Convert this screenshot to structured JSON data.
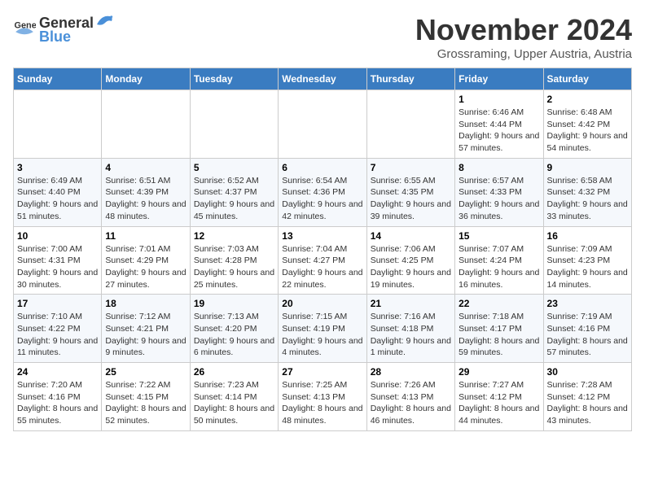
{
  "logo": {
    "text_general": "General",
    "text_blue": "Blue"
  },
  "header": {
    "month_year": "November 2024",
    "location": "Grossraming, Upper Austria, Austria"
  },
  "days_of_week": [
    "Sunday",
    "Monday",
    "Tuesday",
    "Wednesday",
    "Thursday",
    "Friday",
    "Saturday"
  ],
  "weeks": [
    [
      {
        "day": "",
        "detail": ""
      },
      {
        "day": "",
        "detail": ""
      },
      {
        "day": "",
        "detail": ""
      },
      {
        "day": "",
        "detail": ""
      },
      {
        "day": "",
        "detail": ""
      },
      {
        "day": "1",
        "detail": "Sunrise: 6:46 AM\nSunset: 4:44 PM\nDaylight: 9 hours and 57 minutes."
      },
      {
        "day": "2",
        "detail": "Sunrise: 6:48 AM\nSunset: 4:42 PM\nDaylight: 9 hours and 54 minutes."
      }
    ],
    [
      {
        "day": "3",
        "detail": "Sunrise: 6:49 AM\nSunset: 4:40 PM\nDaylight: 9 hours and 51 minutes."
      },
      {
        "day": "4",
        "detail": "Sunrise: 6:51 AM\nSunset: 4:39 PM\nDaylight: 9 hours and 48 minutes."
      },
      {
        "day": "5",
        "detail": "Sunrise: 6:52 AM\nSunset: 4:37 PM\nDaylight: 9 hours and 45 minutes."
      },
      {
        "day": "6",
        "detail": "Sunrise: 6:54 AM\nSunset: 4:36 PM\nDaylight: 9 hours and 42 minutes."
      },
      {
        "day": "7",
        "detail": "Sunrise: 6:55 AM\nSunset: 4:35 PM\nDaylight: 9 hours and 39 minutes."
      },
      {
        "day": "8",
        "detail": "Sunrise: 6:57 AM\nSunset: 4:33 PM\nDaylight: 9 hours and 36 minutes."
      },
      {
        "day": "9",
        "detail": "Sunrise: 6:58 AM\nSunset: 4:32 PM\nDaylight: 9 hours and 33 minutes."
      }
    ],
    [
      {
        "day": "10",
        "detail": "Sunrise: 7:00 AM\nSunset: 4:31 PM\nDaylight: 9 hours and 30 minutes."
      },
      {
        "day": "11",
        "detail": "Sunrise: 7:01 AM\nSunset: 4:29 PM\nDaylight: 9 hours and 27 minutes."
      },
      {
        "day": "12",
        "detail": "Sunrise: 7:03 AM\nSunset: 4:28 PM\nDaylight: 9 hours and 25 minutes."
      },
      {
        "day": "13",
        "detail": "Sunrise: 7:04 AM\nSunset: 4:27 PM\nDaylight: 9 hours and 22 minutes."
      },
      {
        "day": "14",
        "detail": "Sunrise: 7:06 AM\nSunset: 4:25 PM\nDaylight: 9 hours and 19 minutes."
      },
      {
        "day": "15",
        "detail": "Sunrise: 7:07 AM\nSunset: 4:24 PM\nDaylight: 9 hours and 16 minutes."
      },
      {
        "day": "16",
        "detail": "Sunrise: 7:09 AM\nSunset: 4:23 PM\nDaylight: 9 hours and 14 minutes."
      }
    ],
    [
      {
        "day": "17",
        "detail": "Sunrise: 7:10 AM\nSunset: 4:22 PM\nDaylight: 9 hours and 11 minutes."
      },
      {
        "day": "18",
        "detail": "Sunrise: 7:12 AM\nSunset: 4:21 PM\nDaylight: 9 hours and 9 minutes."
      },
      {
        "day": "19",
        "detail": "Sunrise: 7:13 AM\nSunset: 4:20 PM\nDaylight: 9 hours and 6 minutes."
      },
      {
        "day": "20",
        "detail": "Sunrise: 7:15 AM\nSunset: 4:19 PM\nDaylight: 9 hours and 4 minutes."
      },
      {
        "day": "21",
        "detail": "Sunrise: 7:16 AM\nSunset: 4:18 PM\nDaylight: 9 hours and 1 minute."
      },
      {
        "day": "22",
        "detail": "Sunrise: 7:18 AM\nSunset: 4:17 PM\nDaylight: 8 hours and 59 minutes."
      },
      {
        "day": "23",
        "detail": "Sunrise: 7:19 AM\nSunset: 4:16 PM\nDaylight: 8 hours and 57 minutes."
      }
    ],
    [
      {
        "day": "24",
        "detail": "Sunrise: 7:20 AM\nSunset: 4:16 PM\nDaylight: 8 hours and 55 minutes."
      },
      {
        "day": "25",
        "detail": "Sunrise: 7:22 AM\nSunset: 4:15 PM\nDaylight: 8 hours and 52 minutes."
      },
      {
        "day": "26",
        "detail": "Sunrise: 7:23 AM\nSunset: 4:14 PM\nDaylight: 8 hours and 50 minutes."
      },
      {
        "day": "27",
        "detail": "Sunrise: 7:25 AM\nSunset: 4:13 PM\nDaylight: 8 hours and 48 minutes."
      },
      {
        "day": "28",
        "detail": "Sunrise: 7:26 AM\nSunset: 4:13 PM\nDaylight: 8 hours and 46 minutes."
      },
      {
        "day": "29",
        "detail": "Sunrise: 7:27 AM\nSunset: 4:12 PM\nDaylight: 8 hours and 44 minutes."
      },
      {
        "day": "30",
        "detail": "Sunrise: 7:28 AM\nSunset: 4:12 PM\nDaylight: 8 hours and 43 minutes."
      }
    ]
  ]
}
